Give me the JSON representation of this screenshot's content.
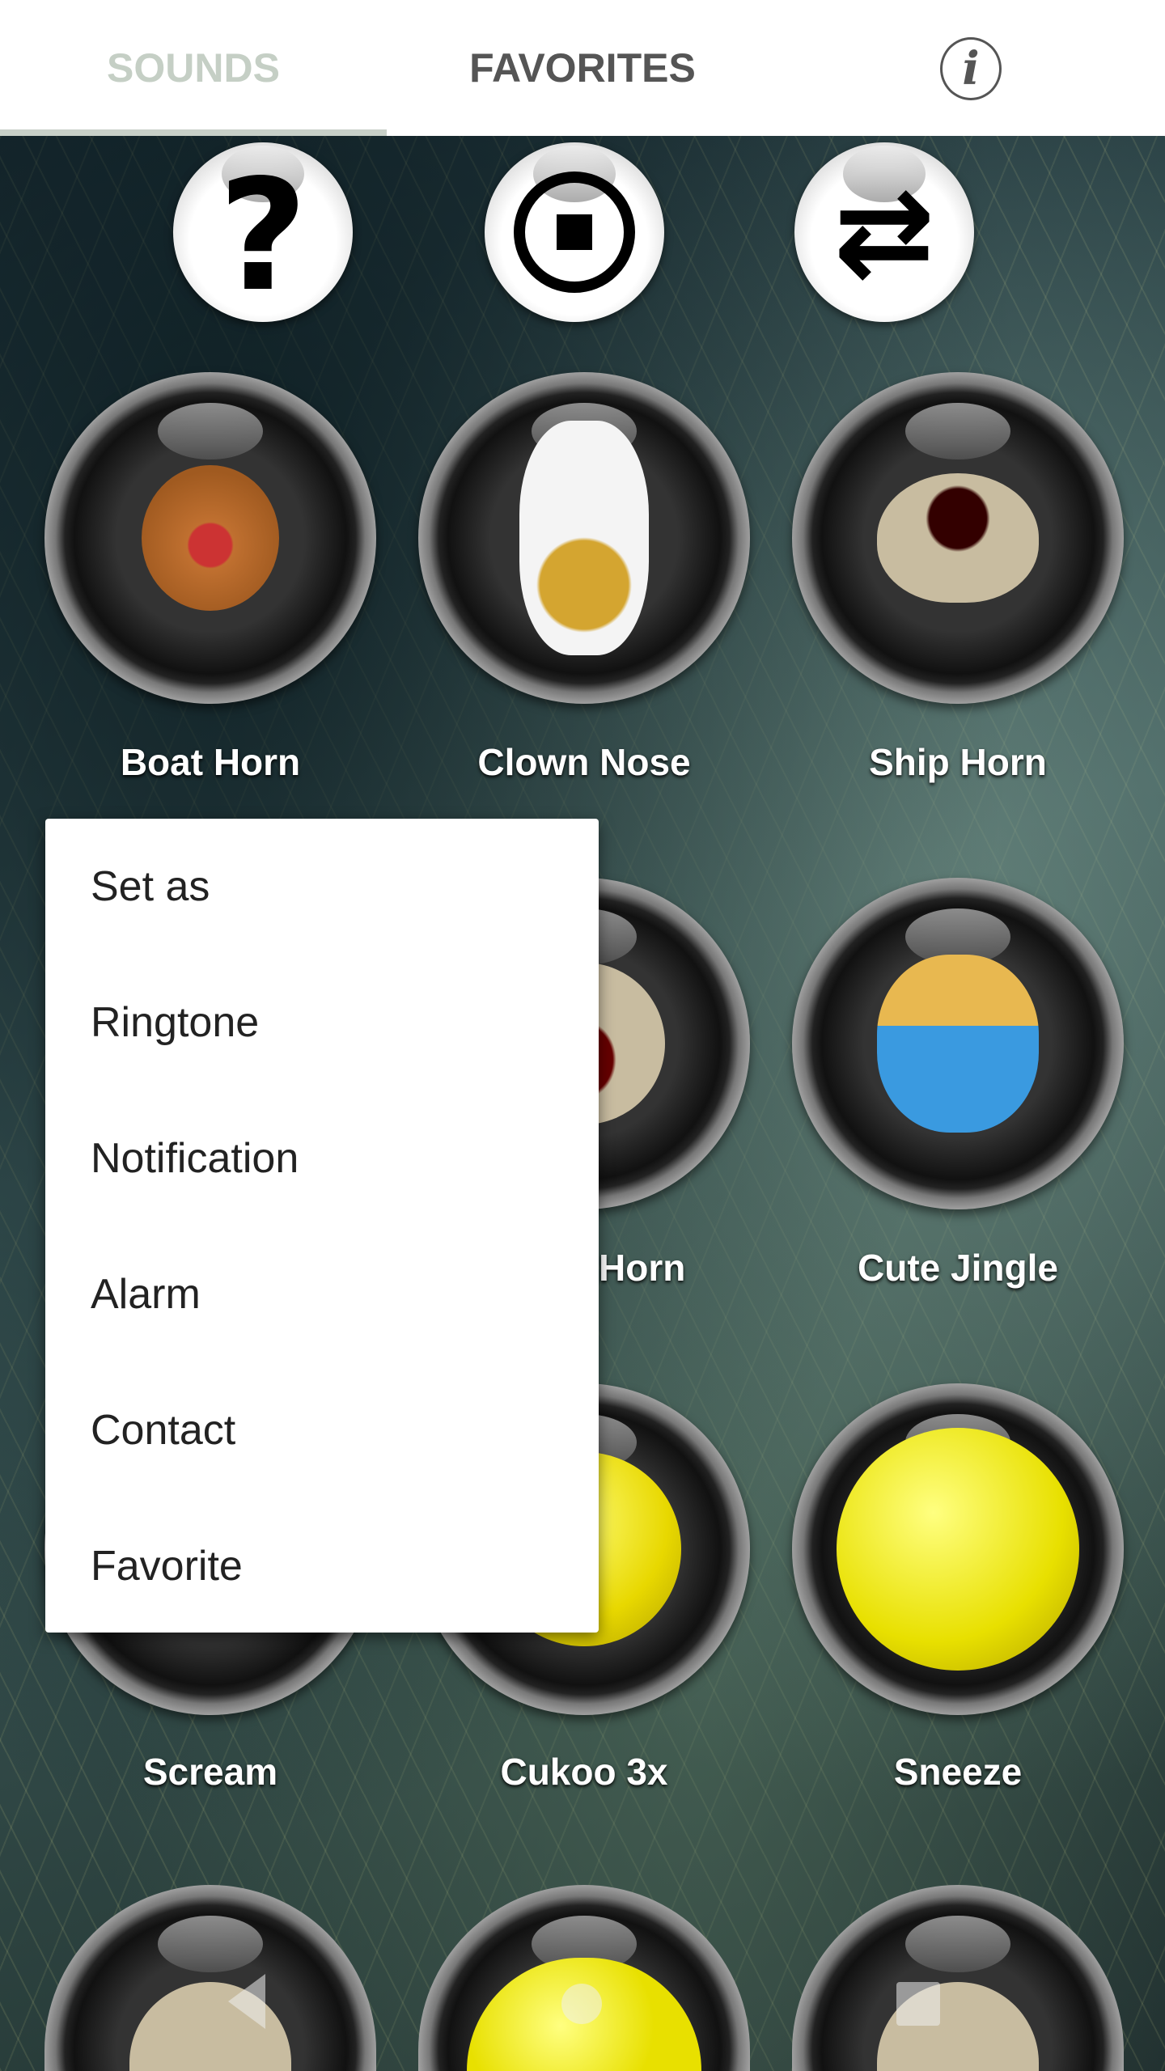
{
  "tabs": [
    {
      "label": "SOUNDS",
      "selected": true
    },
    {
      "label": "FAVORITES",
      "selected": false
    }
  ],
  "info_icon": "info-icon",
  "controls": [
    {
      "name": "help",
      "icon": "question-mark-icon",
      "glyph": "?"
    },
    {
      "name": "stop",
      "icon": "stop-icon"
    },
    {
      "name": "repeat",
      "icon": "repeat-once-icon",
      "glyph": "🔂"
    }
  ],
  "sounds": [
    {
      "label": "Boat Horn",
      "icon": "teddy-bear-icon"
    },
    {
      "label": "Clown Nose",
      "icon": "lucky-cat-icon"
    },
    {
      "label": "Ship Horn",
      "icon": "monster-icon"
    },
    {
      "label": "",
      "icon": "hidden"
    },
    {
      "label": "Horn",
      "icon": "laughing-face-icon"
    },
    {
      "label": "Cute Jingle",
      "icon": "king-smiley-icon"
    },
    {
      "label": "Scream",
      "icon": "hidden"
    },
    {
      "label": "Cukoo 3x",
      "icon": "laughing-smiley-icon"
    },
    {
      "label": "Sneeze",
      "icon": "confused-smiley-icon"
    }
  ],
  "context_menu": {
    "items": [
      "Set as",
      "Ringtone",
      "Notification",
      "Alarm",
      "Contact",
      "Favorite"
    ]
  },
  "colors": {
    "tab_selected": "#c5cfc5",
    "tab_unselected": "#555555",
    "indicator": "#c8d0c8"
  }
}
